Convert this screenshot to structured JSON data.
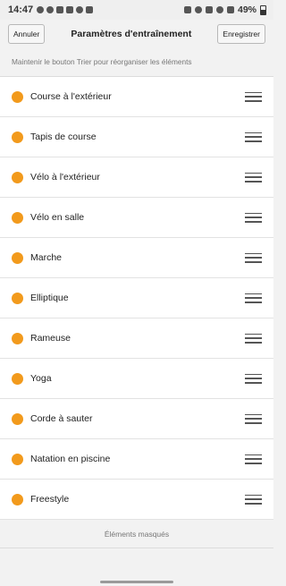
{
  "status_bar": {
    "time": "14:47",
    "battery": "49%"
  },
  "header": {
    "cancel_label": "Annuler",
    "title": "Paramètres d'entraînement",
    "save_label": "Enregistrer"
  },
  "hint": "Maintenir le bouton Trier pour réorganiser les éléments",
  "accent_color": "#f29a1c",
  "activities": [
    {
      "label": "Course à l'extérieur",
      "icon": "run-icon"
    },
    {
      "label": "Tapis de course",
      "icon": "treadmill-icon"
    },
    {
      "label": "Vélo à l'extérieur",
      "icon": "bike-icon"
    },
    {
      "label": "Vélo en salle",
      "icon": "indoor-bike-icon"
    },
    {
      "label": "Marche",
      "icon": "walk-icon"
    },
    {
      "label": "Elliptique",
      "icon": "elliptical-icon"
    },
    {
      "label": "Rameuse",
      "icon": "rower-icon"
    },
    {
      "label": "Yoga",
      "icon": "yoga-icon"
    },
    {
      "label": "Corde à sauter",
      "icon": "jump-rope-icon"
    },
    {
      "label": "Natation en piscine",
      "icon": "swim-icon"
    },
    {
      "label": "Freestyle",
      "icon": "freestyle-icon"
    }
  ],
  "hidden_section_label": "Éléments masqués"
}
